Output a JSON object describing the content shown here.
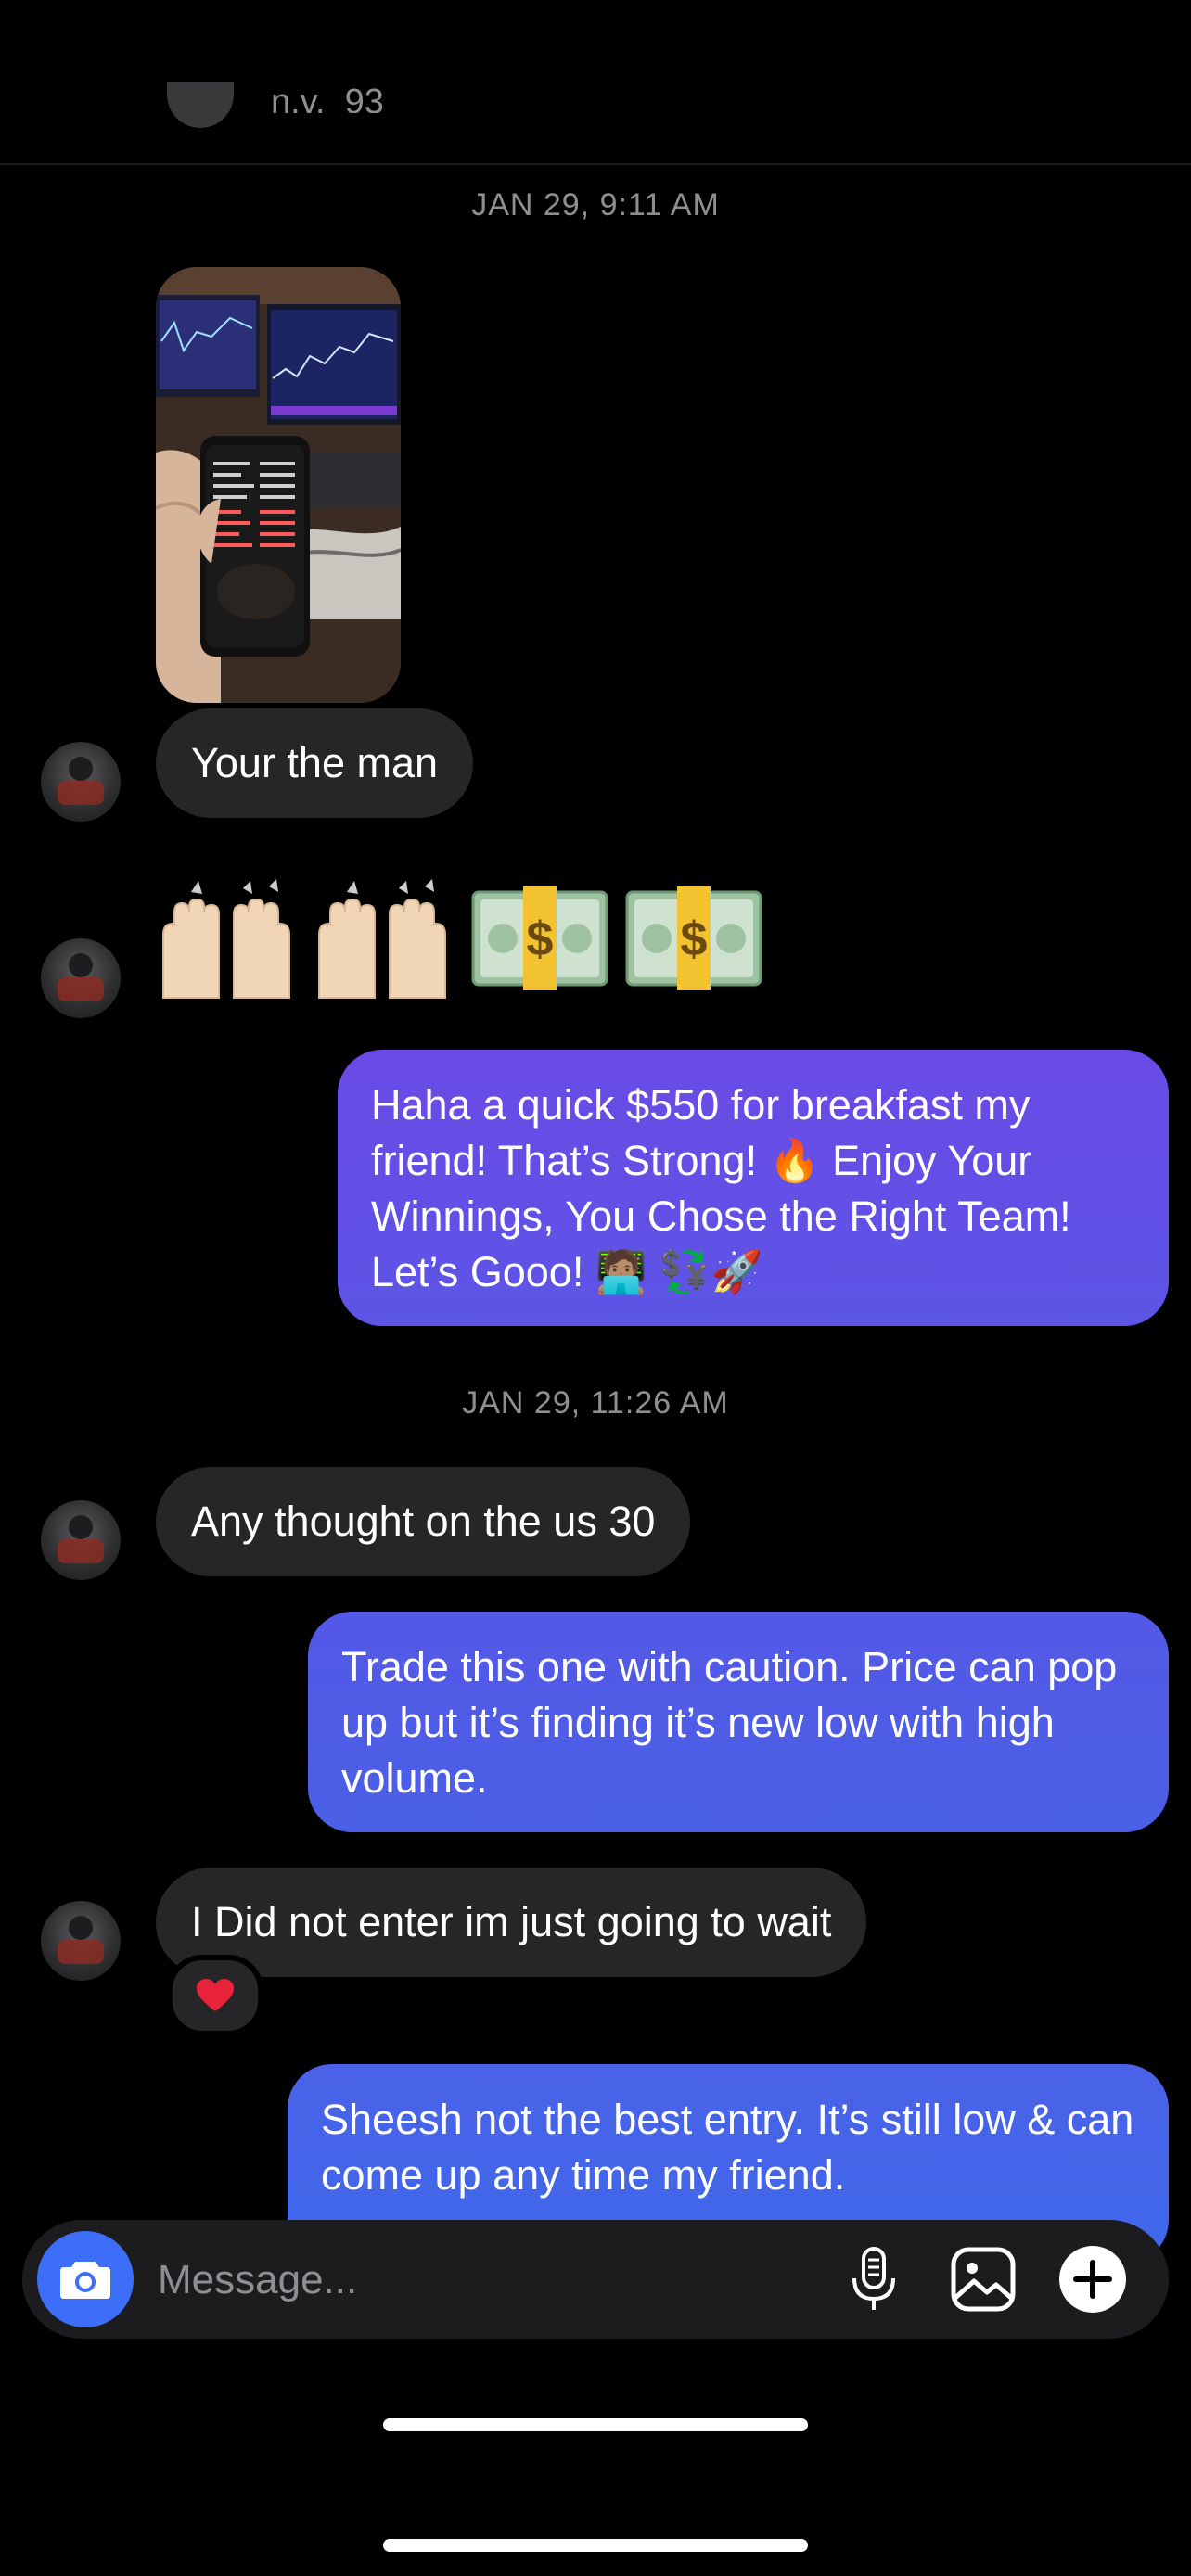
{
  "header": {
    "username": "n.v._93"
  },
  "thread": {
    "timestamp_1": "JAN 29, 9:11 AM",
    "timestamp_2": "JAN 29, 11:26 AM",
    "msg_1": "Your the man",
    "msg_2_emoji": "🙌🏼🙌🏼💵💵",
    "msg_3": "Haha a quick $550 for breakfast my friend! That’s Strong! 🔥 Enjoy Your Winnings, You Chose the Right Team! Let’s Gooo! 🧑🏽‍💻 💱🚀",
    "msg_4": "Any thought on the us 30",
    "msg_5": "Trade this one with caution. Price can pop up but it’s finding it’s new low with high volume.",
    "msg_6": "I Did not enter im just going to wait",
    "msg_6_reaction": "❤️",
    "msg_7": "Sheesh not the best entry. It’s still low & can come up any time my friend."
  },
  "composer": {
    "placeholder": "Message..."
  },
  "icons": {
    "camera": "camera-icon",
    "microphone": "microphone-icon",
    "gallery": "gallery-icon",
    "plus": "plus-icon"
  },
  "colors": {
    "incoming_bubble": "#262628",
    "outgoing_gradient_top": "#6a4ae6",
    "outgoing_gradient_bottom": "#4565e6",
    "camera_button": "#3d6ef7"
  }
}
